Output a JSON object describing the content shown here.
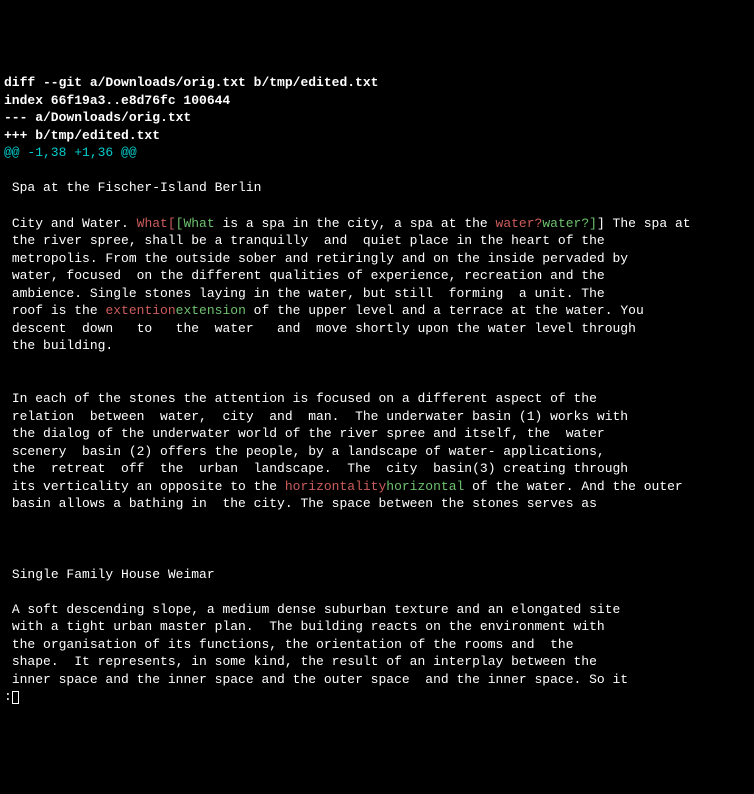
{
  "diff_header": {
    "line1": "diff --git a/Downloads/orig.txt b/tmp/edited.txt",
    "line2": "index 66f19a3..e8d76fc 100644",
    "line3": "--- a/Downloads/orig.txt",
    "line4": "+++ b/tmp/edited.txt"
  },
  "hunk_header": "@@ -1,38 +1,36 @@",
  "body": {
    "blank1": "",
    "title1": " Spa at the Fischer-Island Berlin",
    "blank2": "",
    "p1_a": " City and Water. ",
    "p1_del1": "What[",
    "p1_add1": "[What",
    "p1_b": " is a spa in the city, a spa at the ",
    "p1_del2": "water?",
    "p1_add2": "water?]",
    "p1_c": "] The spa at",
    "p1_l2": " the river spree, shall be a tranquilly  and  quiet place in the heart of the",
    "p1_l3": " metropolis. From the outside sober and retiringly and on the inside pervaded by",
    "p1_l4": " water, focused  on the different qualities of experience, recreation and the",
    "p1_l5": " ambience. Single stones laying in the water, but still  forming  a unit. The",
    "p1_l6a": " roof is the ",
    "p1_del3": "extention",
    "p1_add3": "extension",
    "p1_l6b": " of the upper level and a terrace at the water. You",
    "p1_l7": " descent  down   to   the  water   and  move shortly upon the water level through",
    "p1_l8": " the building.",
    "blank3": "",
    "blank4": "",
    "p2_l1": " In each of the stones the attention is focused on a different aspect of the",
    "p2_l2": " relation  between  water,  city  and  man.  The underwater basin (1) works with",
    "p2_l3": " the dialog of the underwater world of the river spree and itself, the  water",
    "p2_l4": " scenery  basin (2) offers the people, by a landscape of water- applications,",
    "p2_l5": " the  retreat  off  the  urban  landscape.  The  city  basin(3) creating through",
    "p2_l6a": " its verticality an opposite to the ",
    "p2_del1": "horizontality",
    "p2_add1": "horizontal",
    "p2_l6b": " of the water. And the outer",
    "p2_l7": " basin allows a bathing in  the city. The space between the stones serves as",
    "blank5": "",
    "blank6": "",
    "blank7": "",
    "title2": " Single Family House Weimar",
    "blank8": "",
    "p3_l1": " A soft descending slope, a medium dense suburban texture and an elongated site",
    "p3_l2": " with a tight urban master plan.  The building reacts on the environment with",
    "p3_l3": " the organisation of its functions, the orientation of the rooms and  the",
    "p3_l4": " shape.  It represents, in some kind, the result of an interplay between the",
    "p3_l5": " inner space and the inner space and the outer space  and the inner space. So it"
  },
  "prompt": ":"
}
